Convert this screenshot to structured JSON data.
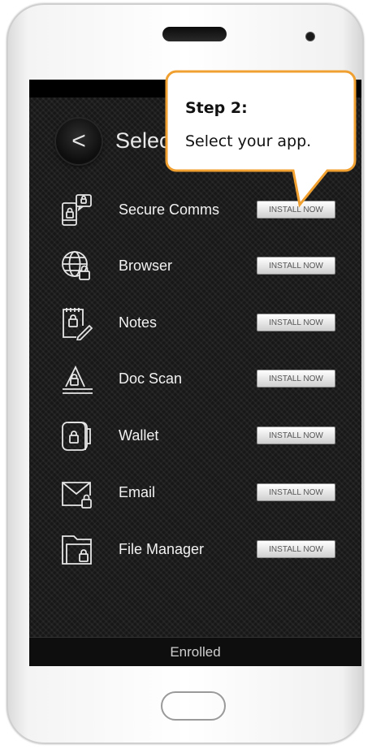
{
  "screen": {
    "title": "Select",
    "back_icon": "<"
  },
  "callout": {
    "step": "Step 2:",
    "text": "Select your app."
  },
  "apps": [
    {
      "label": "Secure Comms",
      "icon": "secure-comms-icon",
      "button": "INSTALL NOW"
    },
    {
      "label": "Browser",
      "icon": "globe-lock-icon",
      "button": "INSTALL NOW"
    },
    {
      "label": "Notes",
      "icon": "notepad-pencil-icon",
      "button": "INSTALL NOW"
    },
    {
      "label": "Doc Scan",
      "icon": "doc-scan-icon",
      "button": "INSTALL NOW"
    },
    {
      "label": "Wallet",
      "icon": "wallet-icon",
      "button": "INSTALL NOW"
    },
    {
      "label": "Email",
      "icon": "envelope-lock-icon",
      "button": "INSTALL NOW"
    },
    {
      "label": "File Manager",
      "icon": "folder-lock-icon",
      "button": "INSTALL NOW"
    }
  ],
  "footer": {
    "status": "Enrolled"
  },
  "colors": {
    "callout_border": "#f0a030",
    "screen_bg": "#171717"
  }
}
